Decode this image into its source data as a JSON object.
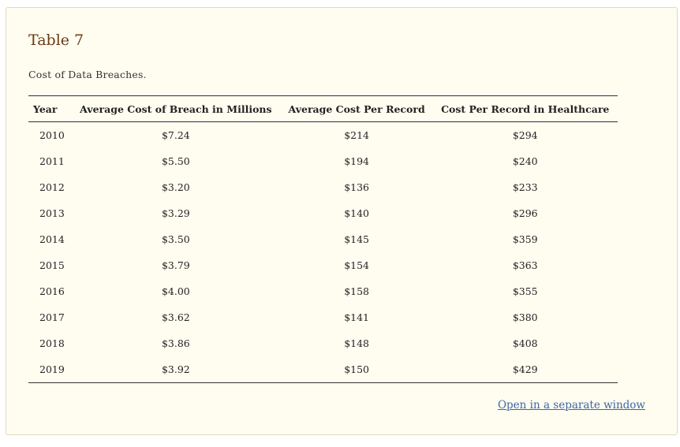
{
  "table": {
    "title": "Table 7",
    "caption": "Cost of Data Breaches.",
    "headers": [
      "Year",
      "Average Cost of Breach in Millions",
      "Average Cost Per Record",
      "Cost Per Record in Healthcare"
    ],
    "rows": [
      [
        "2010",
        "$7.24",
        "$214",
        "$294"
      ],
      [
        "2011",
        "$5.50",
        "$194",
        "$240"
      ],
      [
        "2012",
        "$3.20",
        "$136",
        "$233"
      ],
      [
        "2013",
        "$3.29",
        "$140",
        "$296"
      ],
      [
        "2014",
        "$3.50",
        "$145",
        "$359"
      ],
      [
        "2015",
        "$3.79",
        "$154",
        "$363"
      ],
      [
        "2016",
        "$4.00",
        "$158",
        "$355"
      ],
      [
        "2017",
        "$3.62",
        "$141",
        "$380"
      ],
      [
        "2018",
        "$3.86",
        "$148",
        "$408"
      ],
      [
        "2019",
        "$3.92",
        "$150",
        "$429"
      ]
    ]
  },
  "links": {
    "open_separate": "Open in a separate window"
  },
  "colors": {
    "title": "#6b3a13",
    "link": "#3d66a8",
    "panel_background": "#fffdf0",
    "panel_border": "#e0d9c2"
  }
}
